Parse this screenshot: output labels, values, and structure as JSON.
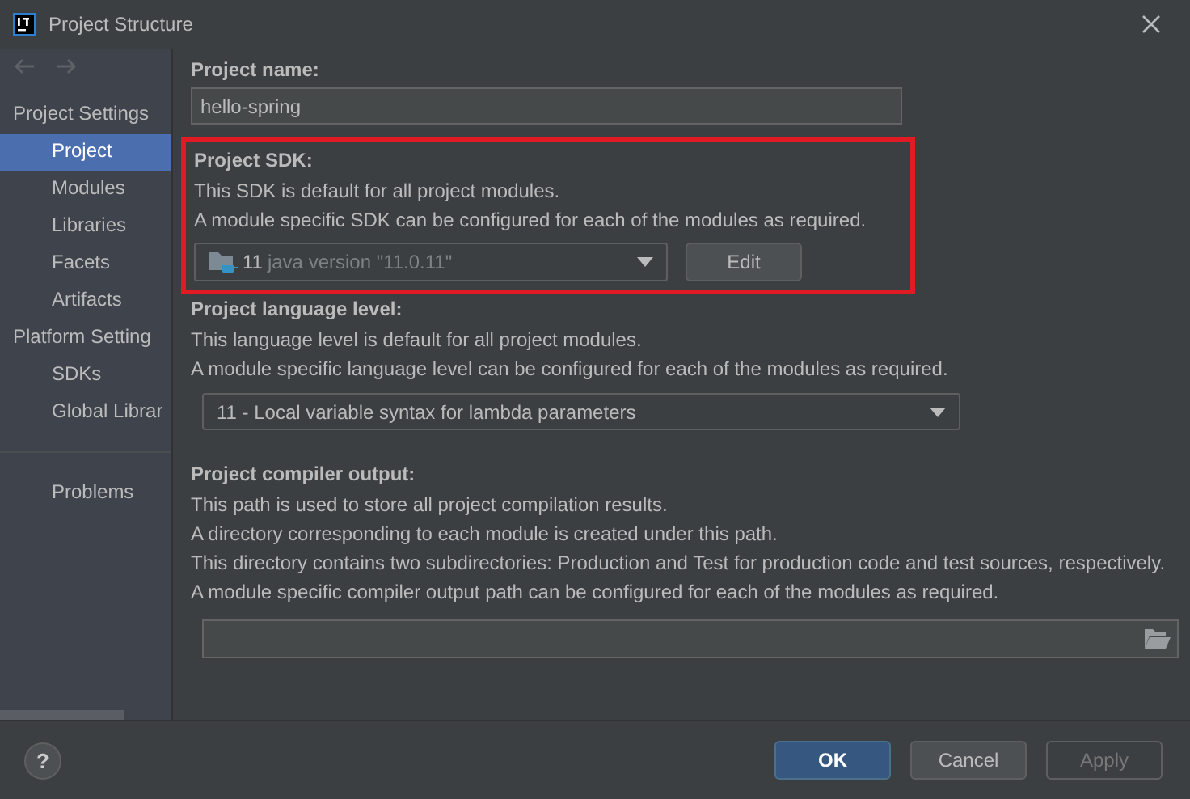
{
  "window": {
    "title": "Project Structure"
  },
  "sidebar": {
    "groups": [
      {
        "label": "Project Settings",
        "items": [
          {
            "label": "Project",
            "selected": true
          },
          {
            "label": "Modules",
            "selected": false
          },
          {
            "label": "Libraries",
            "selected": false
          },
          {
            "label": "Facets",
            "selected": false
          },
          {
            "label": "Artifacts",
            "selected": false
          }
        ]
      },
      {
        "label": "Platform Setting",
        "items": [
          {
            "label": "SDKs",
            "selected": false
          },
          {
            "label": "Global Librar",
            "selected": false
          }
        ]
      },
      {
        "items": [
          {
            "label": "Problems",
            "selected": false
          }
        ]
      }
    ]
  },
  "project_name": {
    "label": "Project name:",
    "value": "hello-spring"
  },
  "project_sdk": {
    "label": "Project SDK:",
    "description": [
      "This SDK is default for all project modules.",
      "A module specific SDK can be configured for each of the modules as required."
    ],
    "value_version": "11",
    "value_detail": "java version \"11.0.11\"",
    "edit_button": "Edit",
    "highlighted": true
  },
  "language_level": {
    "label": "Project language level:",
    "description": [
      "This language level is default for all project modules.",
      "A module specific language level can be configured for each of the modules as required."
    ],
    "value": "11 - Local variable syntax for lambda parameters"
  },
  "compiler_output": {
    "label": "Project compiler output:",
    "description": [
      "This path is used to store all project compilation results.",
      "A directory corresponding to each module is created under this path.",
      "This directory contains two subdirectories: Production and Test for production code and test sources, respectively.",
      "A module specific compiler output path can be configured for each of the modules as required."
    ]
  },
  "help_button": "?",
  "buttons": [
    {
      "label": "OK",
      "kind": "default",
      "disabled": false
    },
    {
      "label": "Cancel",
      "kind": "normal",
      "disabled": false
    },
    {
      "label": "Apply",
      "kind": "normal",
      "disabled": true
    }
  ]
}
